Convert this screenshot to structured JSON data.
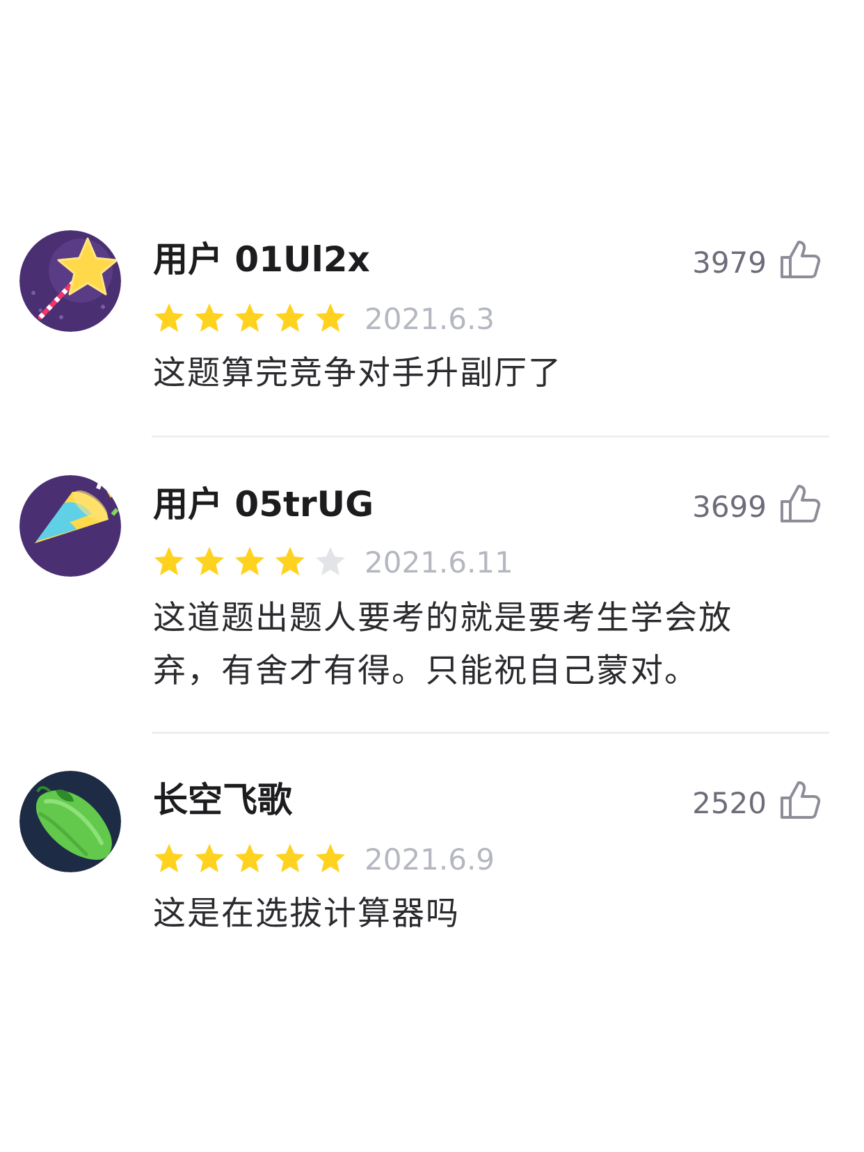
{
  "reviews": [
    {
      "username": "用户 01Ul2x",
      "likes": "3979",
      "rating": 5,
      "max_rating": 5,
      "date": "2021.6.3",
      "comment": "这题算完竞争对手升副厅了",
      "avatar_icon": "magic-wand-star-icon"
    },
    {
      "username": "用户 05trUG",
      "likes": "3699",
      "rating": 4,
      "max_rating": 5,
      "date": "2021.6.11",
      "comment": "这道题出题人要考的就是要考生学会放弃，有舍才有得。只能祝自己蒙对。",
      "avatar_icon": "party-popper-icon"
    },
    {
      "username": "长空飞歌",
      "likes": "2520",
      "rating": 5,
      "max_rating": 5,
      "date": "2021.6.9",
      "comment": "这是在选拔计算器吗",
      "avatar_icon": "cucumber-icon"
    }
  ],
  "colors": {
    "star_filled": "#ffd21f",
    "star_empty": "#e3e4e8",
    "like_icon": "#8d8d99",
    "date": "#b4b7c0"
  }
}
